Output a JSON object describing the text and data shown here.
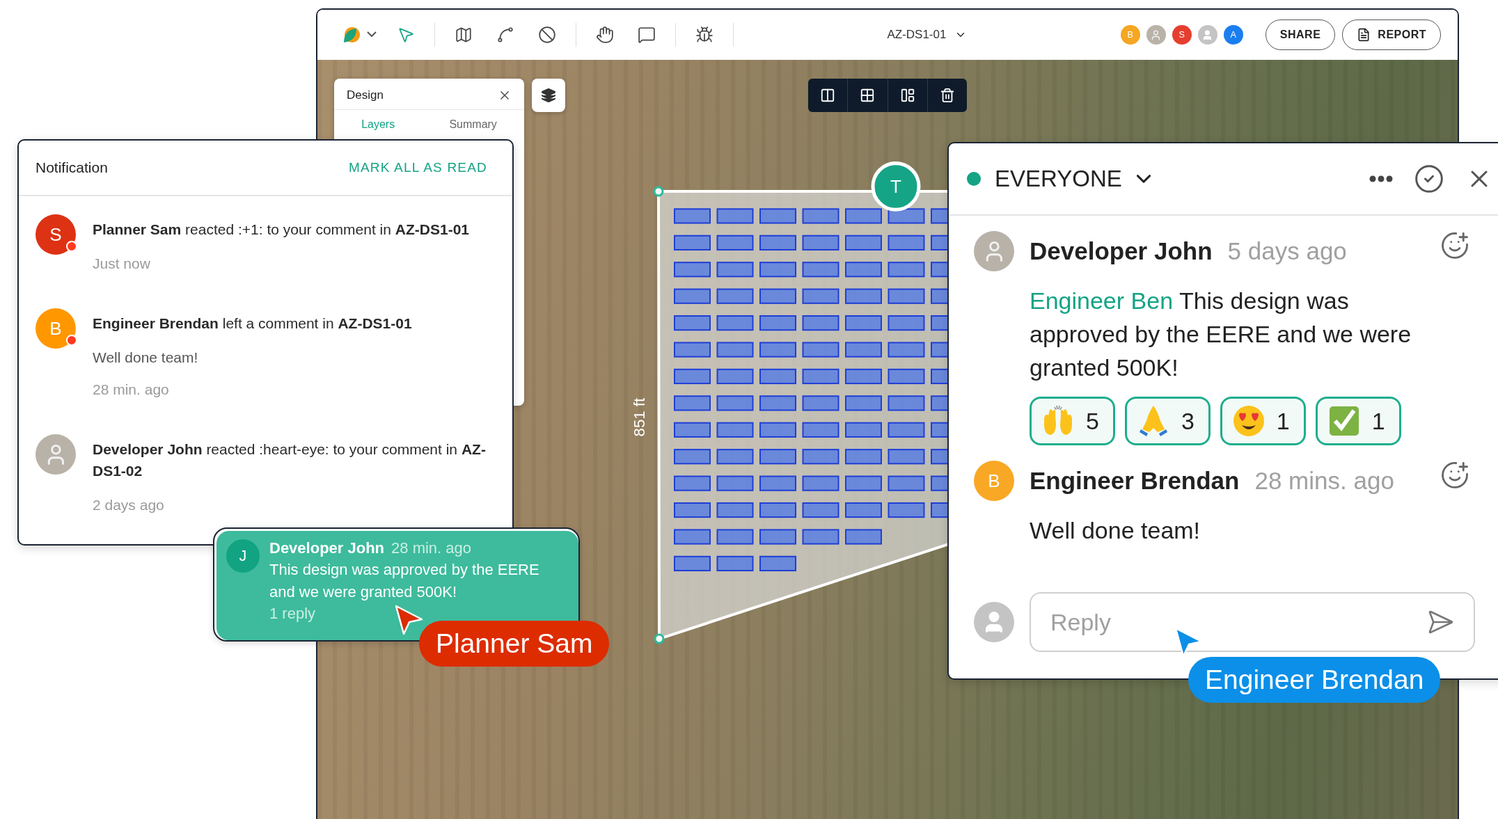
{
  "app_window": {
    "toolbar": {
      "tools": [
        {
          "kind": "pointer",
          "selected": true
        },
        {
          "kind": "map",
          "selected": false
        },
        {
          "kind": "polygon",
          "selected": false
        },
        {
          "kind": "eraser",
          "selected": false
        },
        {
          "kind": "hand",
          "selected": false
        },
        {
          "kind": "comment",
          "selected": false
        },
        {
          "kind": "bug",
          "selected": false
        }
      ],
      "design_name": "AZ-DS1-01",
      "collaborators": [
        {
          "kind": "initial",
          "initial": "B",
          "color": "#f5a623"
        },
        {
          "kind": "photo"
        },
        {
          "kind": "initial",
          "initial": "S",
          "color": "#e53e2f"
        },
        {
          "kind": "generic"
        },
        {
          "kind": "initial",
          "initial": "A",
          "color": "#1a7ef0"
        }
      ],
      "buttons": [
        {
          "kind": "share",
          "label": "SHARE"
        },
        {
          "kind": "report",
          "label": "REPORT"
        }
      ]
    },
    "design_panel": {
      "title": "Design",
      "tabs": [
        {
          "label": "Layers",
          "selected": true
        },
        {
          "label": "Summary",
          "selected": false
        }
      ]
    },
    "map": {
      "dimension_label": "851 ft",
      "marker": {
        "initial": "T"
      }
    }
  },
  "notifications": {
    "title": "Notification",
    "action": "MARK ALL AS READ",
    "items": [
      {
        "avatar": {
          "kind": "initial",
          "initial": "S",
          "color": "#dd3214"
        },
        "unread": true,
        "text": "**Planner Sam** reacted :+1: to your comment in **AZ-DS1-01**",
        "time": "Just now"
      },
      {
        "avatar": {
          "kind": "initial",
          "initial": "B",
          "color": "#ff9800"
        },
        "unread": true,
        "text": "**Engineer Brendan** left a comment in **AZ-DS1-01**",
        "message": "Well done team!",
        "time": "28 min. ago"
      },
      {
        "avatar": {
          "kind": "photo"
        },
        "unread": false,
        "text": "**Developer John** reacted :heart-eye: to your comment in **AZ-DS1-02**",
        "time": "2 days ago"
      }
    ]
  },
  "comment_card": {
    "avatar_initial": "J",
    "author": "Developer John",
    "time": "28 min. ago",
    "body": "This design was approved by the EERE and we were granted 500K!",
    "replies": "1 reply"
  },
  "chat": {
    "channel": "EVERYONE",
    "online": true,
    "comments": [
      {
        "avatar": {
          "kind": "photo"
        },
        "author": "Developer John",
        "time": "5 days ago",
        "mention": "Engineer Ben",
        "body": "This design was approved by the EERE and we were granted 500K!",
        "reactions": [
          {
            "kind": "raised-hands",
            "count": "5"
          },
          {
            "kind": "folded-hands",
            "count": "3"
          },
          {
            "kind": "heart-eyes",
            "count": "1"
          },
          {
            "kind": "check-box",
            "count": "1"
          }
        ]
      },
      {
        "avatar": {
          "kind": "initial",
          "initial": "B",
          "color": "#f9a825"
        },
        "author": "Engineer Brendan",
        "time": "28 mins. ago",
        "body": "Well done team!"
      }
    ],
    "reply": {
      "placeholder": "Reply"
    }
  },
  "cursors": [
    {
      "name": "Planner Sam",
      "color": "#dd2c00"
    },
    {
      "name": "Engineer Brendan",
      "color": "#0b8fe8"
    }
  ]
}
